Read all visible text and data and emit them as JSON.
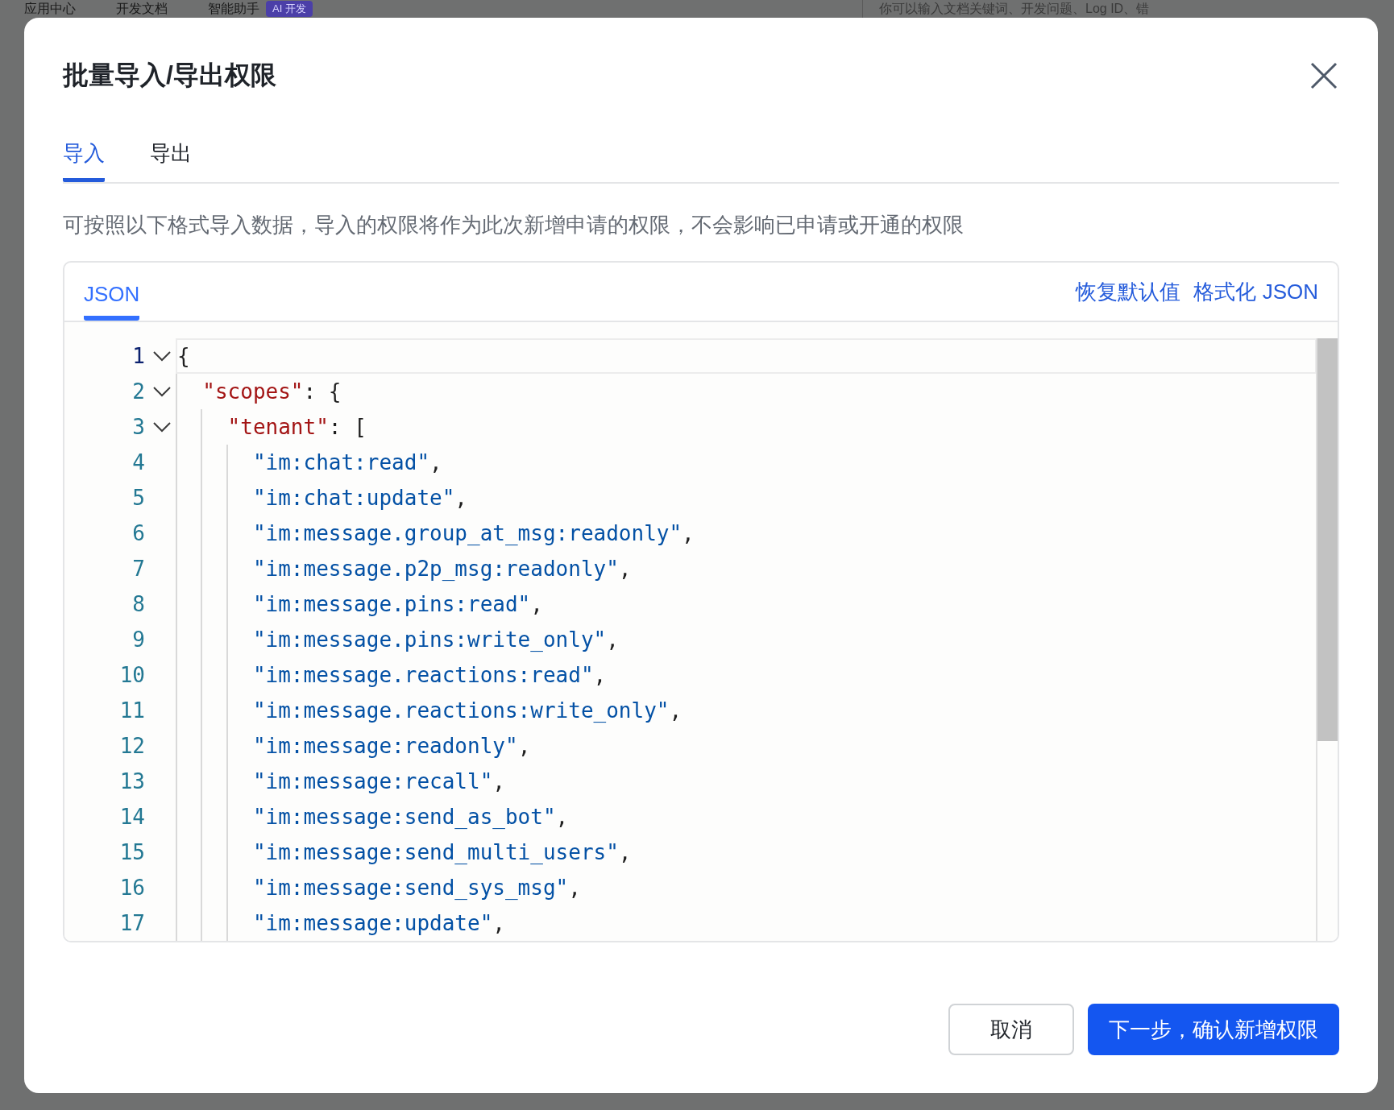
{
  "background_nav": {
    "items": [
      {
        "label": "应用中心"
      },
      {
        "label": "开发文档"
      },
      {
        "label": "智能助手",
        "badge": "AI 开发"
      }
    ],
    "search": {
      "placeholder": "你可以输入文档关键词、开发问题、Log ID、错"
    }
  },
  "dialog": {
    "title": "批量导入/导出权限",
    "tabs": [
      {
        "label": "导入",
        "selected": true
      },
      {
        "label": "导出",
        "selected": false
      }
    ],
    "description": "可按照以下格式导入数据，导入的权限将作为此次新增申请的权限，不会影响已申请或开通的权限",
    "editor": {
      "tabs": [
        {
          "label": "JSON",
          "selected": true
        }
      ],
      "actions": [
        "恢复默认值",
        "格式化 JSON"
      ],
      "lines": [
        {
          "number": "1",
          "current": true,
          "expanded": true,
          "tokens": [
            {
              "kind": "punct",
              "text": "{"
            }
          ],
          "children": [
            {
              "number": "2",
              "current": false,
              "expanded": true,
              "tokens": [
                {
                  "kind": "key",
                  "text": "\"scopes\""
                },
                {
                  "kind": "punct",
                  "text": ": {"
                }
              ],
              "children": [
                {
                  "number": "3",
                  "current": false,
                  "expanded": true,
                  "tokens": [
                    {
                      "kind": "key",
                      "text": "\"tenant\""
                    },
                    {
                      "kind": "punct",
                      "text": ": ["
                    }
                  ],
                  "children": [
                    {
                      "number": "4",
                      "current": false,
                      "tokens": [
                        {
                          "kind": "string",
                          "text": "\"im:chat:read\""
                        },
                        {
                          "kind": "punct",
                          "text": ","
                        }
                      ]
                    },
                    {
                      "number": "5",
                      "current": false,
                      "tokens": [
                        {
                          "kind": "string",
                          "text": "\"im:chat:update\""
                        },
                        {
                          "kind": "punct",
                          "text": ","
                        }
                      ]
                    },
                    {
                      "number": "6",
                      "current": false,
                      "tokens": [
                        {
                          "kind": "string",
                          "text": "\"im:message.group_at_msg:readonly\""
                        },
                        {
                          "kind": "punct",
                          "text": ","
                        }
                      ]
                    },
                    {
                      "number": "7",
                      "current": false,
                      "tokens": [
                        {
                          "kind": "string",
                          "text": "\"im:message.p2p_msg:readonly\""
                        },
                        {
                          "kind": "punct",
                          "text": ","
                        }
                      ]
                    },
                    {
                      "number": "8",
                      "current": false,
                      "tokens": [
                        {
                          "kind": "string",
                          "text": "\"im:message.pins:read\""
                        },
                        {
                          "kind": "punct",
                          "text": ","
                        }
                      ]
                    },
                    {
                      "number": "9",
                      "current": false,
                      "tokens": [
                        {
                          "kind": "string",
                          "text": "\"im:message.pins:write_only\""
                        },
                        {
                          "kind": "punct",
                          "text": ","
                        }
                      ]
                    },
                    {
                      "number": "10",
                      "current": false,
                      "tokens": [
                        {
                          "kind": "string",
                          "text": "\"im:message.reactions:read\""
                        },
                        {
                          "kind": "punct",
                          "text": ","
                        }
                      ]
                    },
                    {
                      "number": "11",
                      "current": false,
                      "tokens": [
                        {
                          "kind": "string",
                          "text": "\"im:message.reactions:write_only\""
                        },
                        {
                          "kind": "punct",
                          "text": ","
                        }
                      ]
                    },
                    {
                      "number": "12",
                      "current": false,
                      "tokens": [
                        {
                          "kind": "string",
                          "text": "\"im:message:readonly\""
                        },
                        {
                          "kind": "punct",
                          "text": ","
                        }
                      ]
                    },
                    {
                      "number": "13",
                      "current": false,
                      "tokens": [
                        {
                          "kind": "string",
                          "text": "\"im:message:recall\""
                        },
                        {
                          "kind": "punct",
                          "text": ","
                        }
                      ]
                    },
                    {
                      "number": "14",
                      "current": false,
                      "tokens": [
                        {
                          "kind": "string",
                          "text": "\"im:message:send_as_bot\""
                        },
                        {
                          "kind": "punct",
                          "text": ","
                        }
                      ]
                    },
                    {
                      "number": "15",
                      "current": false,
                      "tokens": [
                        {
                          "kind": "string",
                          "text": "\"im:message:send_multi_users\""
                        },
                        {
                          "kind": "punct",
                          "text": ","
                        }
                      ]
                    },
                    {
                      "number": "16",
                      "current": false,
                      "tokens": [
                        {
                          "kind": "string",
                          "text": "\"im:message:send_sys_msg\""
                        },
                        {
                          "kind": "punct",
                          "text": ","
                        }
                      ]
                    },
                    {
                      "number": "17",
                      "current": false,
                      "tokens": [
                        {
                          "kind": "string",
                          "text": "\"im:message:update\""
                        },
                        {
                          "kind": "punct",
                          "text": ","
                        }
                      ]
                    }
                  ]
                }
              ]
            }
          ]
        }
      ]
    },
    "buttons": [
      {
        "label": "取消",
        "kind": "secondary"
      },
      {
        "label": "下一步，确认新增权限",
        "kind": "primary"
      }
    ]
  }
}
